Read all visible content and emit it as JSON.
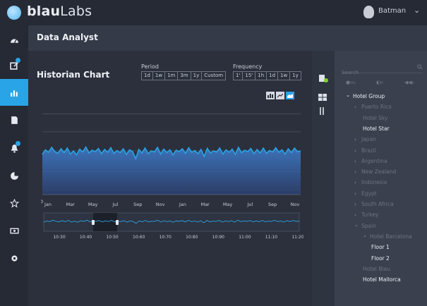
{
  "app": {
    "logo_text_bold": "blau",
    "logo_text_light": "Labs",
    "user_name": "Batman",
    "section_title": "Data Analyst"
  },
  "sidebar": {
    "items": [
      {
        "icon": "dashboard-icon",
        "active": false,
        "badge": false
      },
      {
        "icon": "edit-icon",
        "active": false,
        "badge": true
      },
      {
        "icon": "chart-icon",
        "active": true,
        "badge": false
      },
      {
        "icon": "document-icon",
        "active": false,
        "badge": false
      },
      {
        "icon": "bell-icon",
        "active": false,
        "badge": true
      },
      {
        "icon": "pie-icon",
        "active": false,
        "badge": false
      },
      {
        "icon": "star-icon",
        "active": false,
        "badge": false
      },
      {
        "icon": "money-icon",
        "active": false,
        "badge": false
      },
      {
        "icon": "gear-icon",
        "active": false,
        "badge": false
      }
    ]
  },
  "chart_panel": {
    "title": "Historian Chart",
    "period_label": "Period",
    "period_options": [
      "1d",
      "1w",
      "1m",
      "3m",
      "1y",
      "Custom"
    ],
    "frequency_label": "Frequency",
    "frequency_options": [
      "1'",
      "15'",
      "1h",
      "1d",
      "1w",
      "1y"
    ],
    "chart_types": [
      "bar-chart-icon",
      "line-chart-icon",
      "area-chart-icon"
    ],
    "active_chart_type": "area-chart-icon"
  },
  "chart_data": {
    "type": "area",
    "title": "",
    "xlabel": "",
    "ylabel": "",
    "y_tick_labels": [
      "0",
      "",
      "",
      "",
      ""
    ],
    "x_tick_labels": [
      "Jan",
      "Mar",
      "May",
      "Jul",
      "Sep",
      "Nov",
      "Jan",
      "Mar",
      "May",
      "Jul",
      "Sep",
      "Nov"
    ],
    "overview_tick_labels": [
      "10:30",
      "10:40",
      "10:50",
      "10:60",
      "10:70",
      "10:80",
      "10:90",
      "11:00",
      "11:10",
      "11:20"
    ],
    "series": [
      {
        "values": [
          0.42,
          0.55,
          0.48,
          0.62,
          0.5,
          0.45,
          0.58,
          0.47,
          0.6,
          0.43,
          0.52,
          0.41,
          0.57,
          0.49,
          0.63,
          0.46,
          0.54,
          0.5,
          0.59,
          0.44,
          0.56,
          0.48,
          0.61,
          0.45,
          0.53,
          0.47,
          0.58,
          0.42,
          0.55,
          0.5,
          0.3,
          0.56,
          0.46,
          0.6,
          0.44,
          0.52,
          0.49,
          0.62,
          0.43,
          0.57,
          0.47,
          0.55,
          0.41,
          0.54,
          0.5,
          0.58,
          0.45,
          0.61,
          0.48,
          0.53,
          0.44,
          0.56,
          0.36,
          0.59,
          0.46,
          0.52,
          0.49,
          0.6,
          0.43,
          0.55,
          0.48,
          0.57,
          0.42,
          0.62,
          0.47,
          0.54,
          0.5,
          0.59,
          0.44,
          0.56,
          0.46,
          0.6,
          0.45,
          0.53,
          0.49,
          0.61,
          0.48,
          0.55,
          0.43,
          0.58,
          0.47,
          0.6,
          0.5,
          0.52
        ]
      }
    ],
    "grid": true,
    "ylim": [
      0,
      1
    ]
  },
  "mid_strip": {
    "icons": [
      "group-online-icon",
      "grid-icon",
      "sort-icon"
    ]
  },
  "right_panel": {
    "search_placeholder": "Search",
    "filters": [
      {
        "icon": "tag-icon",
        "badge": "TAG"
      },
      {
        "icon": "ip-icon",
        "badge": "IP"
      },
      {
        "icon": "sound-icon",
        "badge": "H"
      }
    ],
    "tree": [
      {
        "label": "Hotel Group",
        "level": 0,
        "chevron": "down",
        "style": "bright"
      },
      {
        "label": "Puerto Rico",
        "level": 1,
        "chevron": "right",
        "style": "dim"
      },
      {
        "label": "Hotel Sky",
        "level": 2,
        "chevron": "",
        "style": "dim"
      },
      {
        "label": "Hotel Star",
        "level": 2,
        "chevron": "",
        "style": "bright"
      },
      {
        "label": "Japan",
        "level": 1,
        "chevron": "right",
        "style": "dim"
      },
      {
        "label": "Brazil",
        "level": 1,
        "chevron": "right",
        "style": "dim"
      },
      {
        "label": "Argentina",
        "level": 1,
        "chevron": "right",
        "style": "dim"
      },
      {
        "label": "New Zealand",
        "level": 1,
        "chevron": "right",
        "style": "dim"
      },
      {
        "label": "Indonesia",
        "level": 1,
        "chevron": "right",
        "style": "dim"
      },
      {
        "label": "Egypt",
        "level": 1,
        "chevron": "right",
        "style": "dim"
      },
      {
        "label": "South Africa",
        "level": 1,
        "chevron": "right",
        "style": "dim"
      },
      {
        "label": "Turkey",
        "level": 1,
        "chevron": "right",
        "style": "dim"
      },
      {
        "label": "Spain",
        "level": 1,
        "chevron": "down",
        "style": "dim"
      },
      {
        "label": "Hotel Barcelona",
        "level": 2,
        "chevron": "down",
        "style": "dim"
      },
      {
        "label": "Floor 1",
        "level": 3,
        "chevron": "",
        "style": "bright"
      },
      {
        "label": "Floor 2",
        "level": 3,
        "chevron": "",
        "style": "bright"
      },
      {
        "label": "Hotel Blau",
        "level": 2,
        "chevron": "",
        "style": "dim"
      },
      {
        "label": "Hotel Mallorca",
        "level": 2,
        "chevron": "",
        "style": "bright"
      }
    ]
  },
  "colors": {
    "accent": "#29a4e6",
    "background": "#2b303c",
    "panel": "#3a404e"
  }
}
